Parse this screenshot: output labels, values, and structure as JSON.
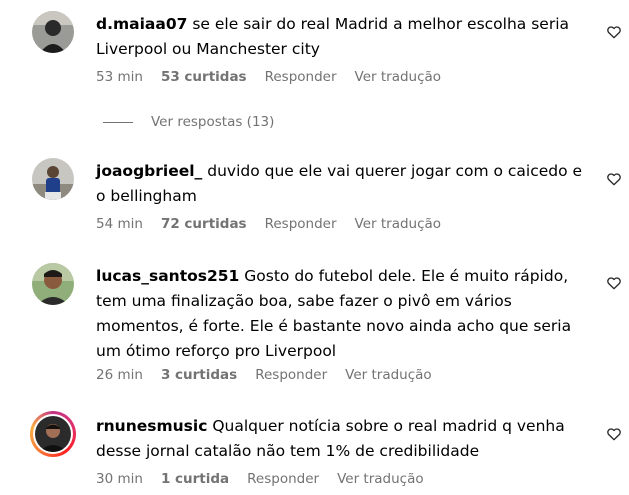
{
  "comments": [
    {
      "username": "d.maiaa07",
      "text": "se ele sair do real Madrid a melhor escolha seria Liverpool ou Manchester city",
      "time": "53 min",
      "likes": "53 curtidas",
      "reply": "Responder",
      "translate": "Ver tradução",
      "icon": "heart-outline-icon"
    },
    {
      "username": "joaogbrieel_",
      "text": "duvido que ele vai querer jogar com o caicedo e o bellingham",
      "time": "54 min",
      "likes": "72 curtidas",
      "reply": "Responder",
      "translate": "Ver tradução",
      "icon": "heart-outline-icon"
    },
    {
      "username": "lucas_santos251",
      "text": "Gosto do futebol dele. Ele é muito rápido, tem uma finalização boa, sabe fazer o pivô em vários momentos, é forte. Ele é bastante novo ainda acho que seria um ótimo reforço pro Liverpool",
      "time": "26 min",
      "likes": "3 curtidas",
      "reply": "Responder",
      "translate": "Ver tradução",
      "icon": "heart-outline-icon"
    },
    {
      "username": "rnunesmusic",
      "text": "Qualquer notícia sobre o real madrid q venha desse jornal catalão não tem 1% de credibilidade",
      "time": "30 min",
      "likes": "1 curtida",
      "reply": "Responder",
      "translate": "Ver tradução",
      "icon": "heart-outline-icon"
    }
  ],
  "view_replies": "Ver respostas (13)",
  "colors": {
    "text": "#000000",
    "secondary": "#737373",
    "story_ring": "#e1306c"
  }
}
